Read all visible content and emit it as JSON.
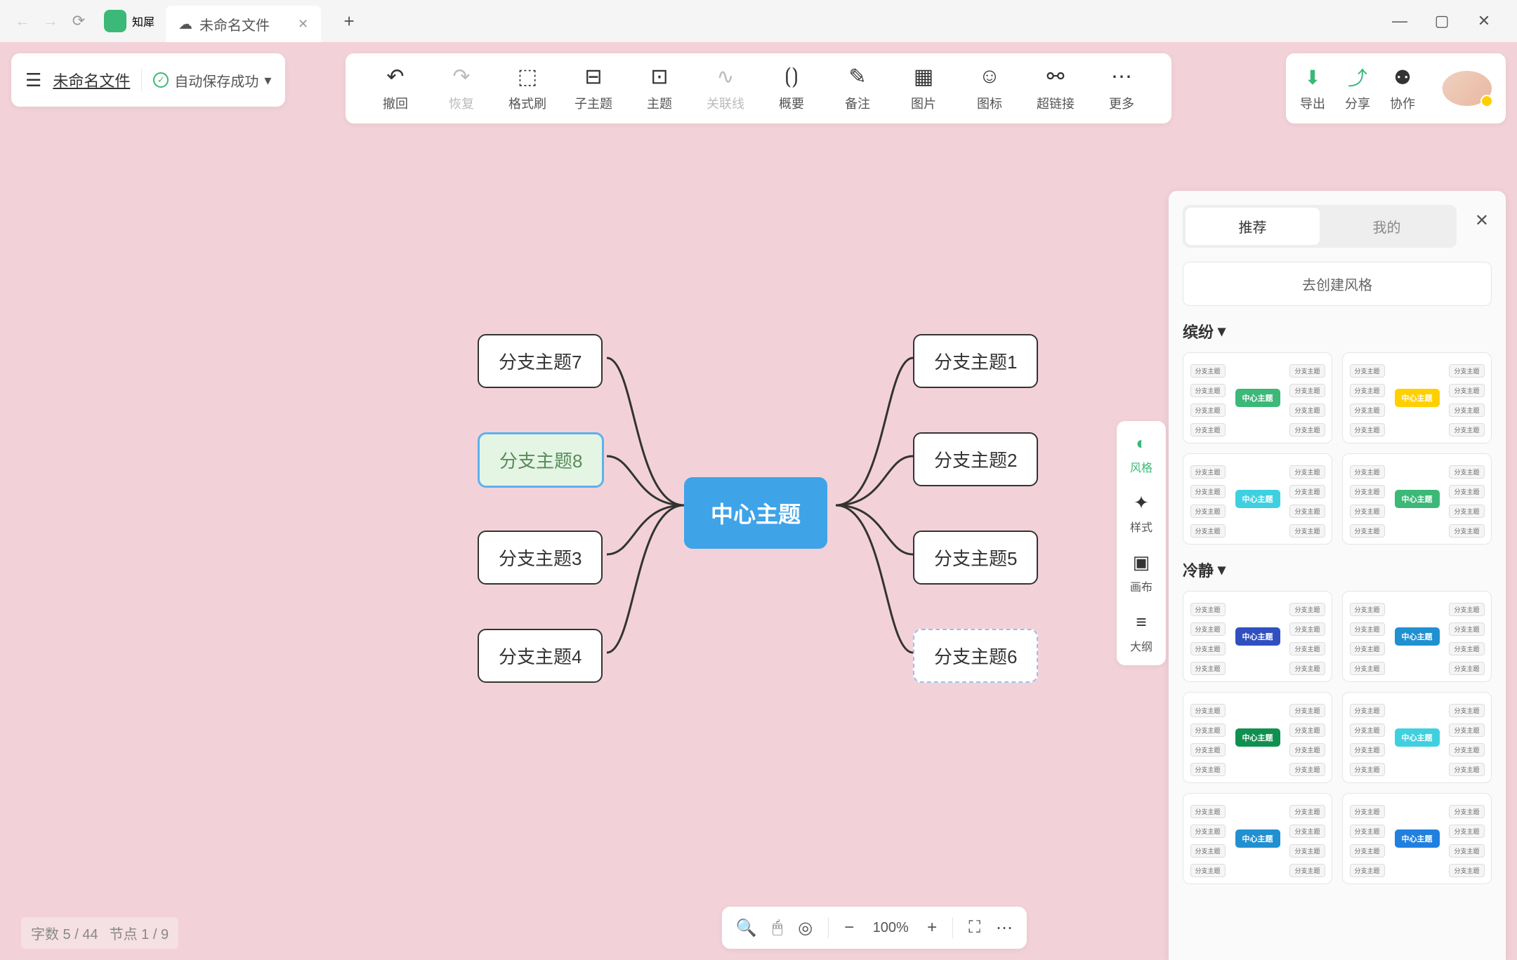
{
  "browser": {
    "app_name": "知犀",
    "tab_title": "未命名文件"
  },
  "file_bar": {
    "file_name": "未命名文件",
    "save_status": "自动保存成功"
  },
  "toolbar": {
    "items": [
      {
        "label": "撤回",
        "icon": "↶",
        "disabled": false
      },
      {
        "label": "恢复",
        "icon": "↷",
        "disabled": true
      },
      {
        "label": "格式刷",
        "icon": "⬚",
        "disabled": false
      },
      {
        "label": "子主题",
        "icon": "⊟",
        "disabled": false
      },
      {
        "label": "主题",
        "icon": "⊡",
        "disabled": false
      },
      {
        "label": "关联线",
        "icon": "∿",
        "disabled": true
      },
      {
        "label": "概要",
        "icon": "⟮⟯",
        "disabled": false
      },
      {
        "label": "备注",
        "icon": "✎",
        "disabled": false
      },
      {
        "label": "图片",
        "icon": "▦",
        "disabled": false
      },
      {
        "label": "图标",
        "icon": "☺",
        "disabled": false
      },
      {
        "label": "超链接",
        "icon": "⚯",
        "disabled": false
      },
      {
        "label": "更多",
        "icon": "⋯",
        "disabled": false
      }
    ]
  },
  "actions": {
    "export": "导出",
    "share": "分享",
    "collab": "协作"
  },
  "mindmap": {
    "center": "中心主题",
    "right": [
      "分支主题1",
      "分支主题2",
      "分支主题5",
      "分支主题6"
    ],
    "left": [
      "分支主题7",
      "分支主题8",
      "分支主题3",
      "分支主题4"
    ],
    "selected": "分支主题8",
    "hovered": "分支主题6"
  },
  "side_tools": [
    {
      "label": "风格",
      "icon": "◐",
      "active": true
    },
    {
      "label": "样式",
      "icon": "✦",
      "active": false
    },
    {
      "label": "画布",
      "icon": "▣",
      "active": false
    },
    {
      "label": "大纲",
      "icon": "≡",
      "active": false
    }
  ],
  "style_panel": {
    "tabs": {
      "recommend": "推荐",
      "mine": "我的"
    },
    "create": "去创建风格",
    "sections": [
      {
        "title": "缤纷",
        "themes": [
          {
            "center_bg": "#3cb878",
            "accent": "multi"
          },
          {
            "center_bg": "#ffd000",
            "accent": "multi"
          },
          {
            "center_bg": "#3fd0e0",
            "accent": "mono"
          },
          {
            "center_bg": "#3cb878",
            "accent": "rainbow"
          }
        ]
      },
      {
        "title": "冷静",
        "themes": [
          {
            "center_bg": "#3050c0",
            "accent": "purple"
          },
          {
            "center_bg": "#2090d0",
            "accent": "dark"
          },
          {
            "center_bg": "#109050",
            "accent": "green"
          },
          {
            "center_bg": "#3fd0e0",
            "accent": "teal"
          },
          {
            "center_bg": "#2090d0",
            "accent": "blue"
          },
          {
            "center_bg": "#2080e0",
            "accent": "blue2"
          }
        ]
      }
    ],
    "mini_center_label": "中心主题",
    "mini_branch_label": "分支主题"
  },
  "status": {
    "chars": "字数 5 / 44",
    "nodes": "节点 1 / 9"
  },
  "zoom": {
    "value": "100%"
  }
}
